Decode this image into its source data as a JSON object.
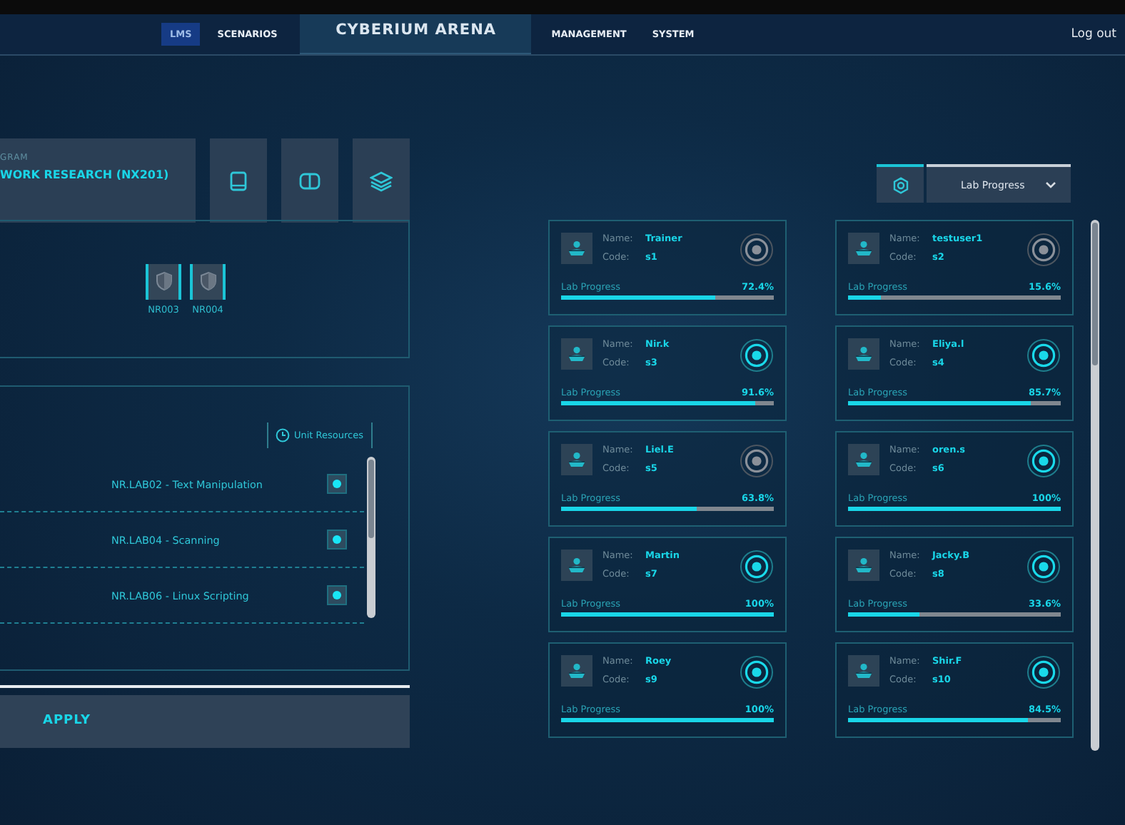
{
  "nav": {
    "left": [
      {
        "label": "LMS",
        "selected": true
      },
      {
        "label": "SCENARIOS",
        "selected": false
      }
    ],
    "title": "CYBERIUM ARENA",
    "right": [
      {
        "label": "MANAGEMENT",
        "selected": false
      },
      {
        "label": "SYSTEM",
        "selected": false
      }
    ],
    "logout": "Log out"
  },
  "program": {
    "label": "GRAM",
    "name": "WORK RESEARCH (NX201)"
  },
  "nodes": [
    "NR003",
    "NR004"
  ],
  "unit_resources": "Unit Resources",
  "labs": [
    {
      "name": "NR.LAB02 - Text Manipulation",
      "checked": true
    },
    {
      "name": "NR.LAB04 - Scanning",
      "checked": true
    },
    {
      "name": "NR.LAB06 - Linux Scripting",
      "checked": true
    }
  ],
  "apply": "APPLY",
  "view_select": "Lab Progress",
  "students": [
    {
      "name_label": "Name:",
      "name": "Trainer",
      "code_label": "Code:",
      "code": "s1",
      "online": false,
      "progress_label": "Lab Progress",
      "level": 0.724,
      "reading": "72.4%"
    },
    {
      "name_label": "Name:",
      "name": "testuser1",
      "code_label": "Code:",
      "code": "s2",
      "online": false,
      "progress_label": "Lab Progress",
      "level": 0.156,
      "reading": "15.6%"
    },
    {
      "name_label": "Name:",
      "name": "Nir.k",
      "code_label": "Code:",
      "code": "s3",
      "online": true,
      "progress_label": "Lab Progress",
      "level": 0.916,
      "reading": "91.6%"
    },
    {
      "name_label": "Name:",
      "name": "Eliya.l",
      "code_label": "Code:",
      "code": "s4",
      "online": true,
      "progress_label": "Lab Progress",
      "level": 0.857,
      "reading": "85.7%"
    },
    {
      "name_label": "Name:",
      "name": "Liel.E",
      "code_label": "Code:",
      "code": "s5",
      "online": false,
      "progress_label": "Lab Progress",
      "level": 0.638,
      "reading": "63.8%"
    },
    {
      "name_label": "Name:",
      "name": "oren.s",
      "code_label": "Code:",
      "code": "s6",
      "online": true,
      "progress_label": "Lab Progress",
      "level": 1,
      "reading": "100%"
    },
    {
      "name_label": "Name:",
      "name": "Martin",
      "code_label": "Code:",
      "code": "s7",
      "online": true,
      "progress_label": "Lab Progress",
      "level": 1,
      "reading": "100%"
    },
    {
      "name_label": "Name:",
      "name": "Jacky.B",
      "code_label": "Code:",
      "code": "s8",
      "online": true,
      "progress_label": "Lab Progress",
      "level": 0.336,
      "reading": "33.6%"
    },
    {
      "name_label": "Name:",
      "name": "Roey",
      "code_label": "Code:",
      "code": "s9",
      "online": true,
      "progress_label": "Lab Progress",
      "level": 1,
      "reading": "100%"
    },
    {
      "name_label": "Name:",
      "name": "Shir.F",
      "code_label": "Code:",
      "code": "s10",
      "online": true,
      "progress_label": "Lab Progress",
      "level": 0.845,
      "reading": "84.5%"
    }
  ]
}
